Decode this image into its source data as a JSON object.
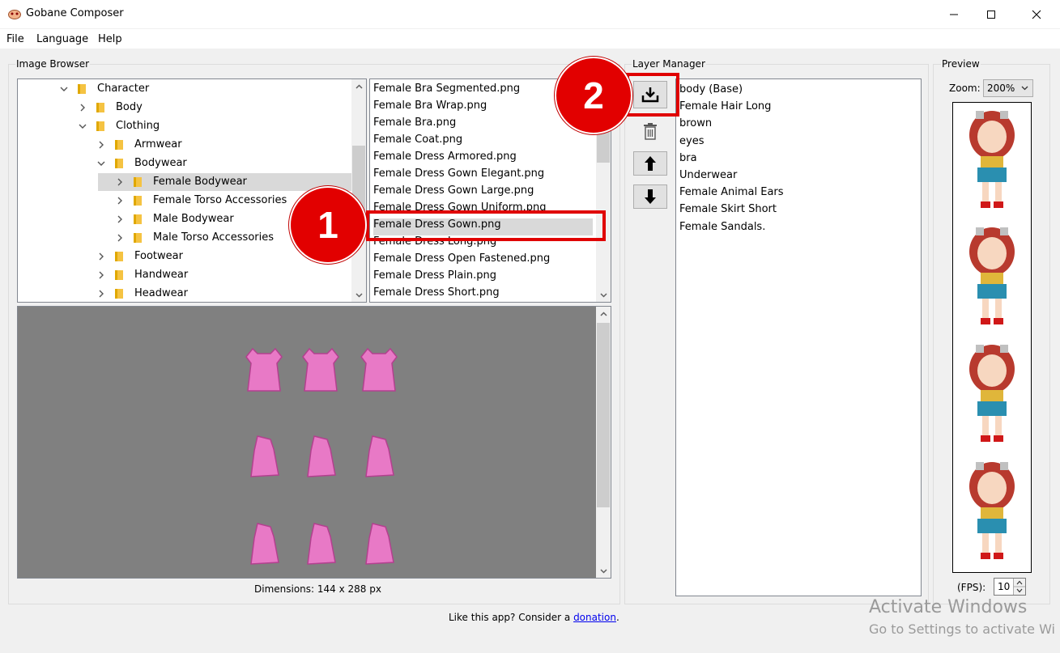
{
  "window": {
    "title": "Gobane Composer"
  },
  "menu": {
    "items": [
      "File",
      "Language",
      "Help"
    ]
  },
  "image_browser": {
    "label": "Image Browser",
    "tree": [
      {
        "label": "Character",
        "expanded": true
      },
      {
        "label": "Body",
        "expanded": false
      },
      {
        "label": "Clothing",
        "expanded": true
      },
      {
        "label": "Armwear",
        "expanded": false
      },
      {
        "label": "Bodywear",
        "expanded": true
      },
      {
        "label": "Female Bodywear",
        "expanded": false,
        "selected": true
      },
      {
        "label": "Female Torso Accessories",
        "expanded": false
      },
      {
        "label": "Male Bodywear",
        "expanded": false
      },
      {
        "label": "Male Torso Accessories",
        "expanded": false
      },
      {
        "label": "Footwear",
        "expanded": false
      },
      {
        "label": "Handwear",
        "expanded": false
      },
      {
        "label": "Headwear",
        "expanded": false
      }
    ],
    "files": [
      "Female Bra Segmented.png",
      "Female Bra Wrap.png",
      "Female Bra.png",
      "Female Coat.png",
      "Female Dress Armored.png",
      "Female Dress Gown Elegant.png",
      "Female Dress Gown Large.png",
      "Female Dress Gown Uniform.png",
      "Female Dress Gown.png",
      "Female Dress Long.png",
      "Female Dress Open Fastened.png",
      "Female Dress Plain.png",
      "Female Dress Short.png"
    ],
    "selected_file": "Female Dress Gown.png",
    "dimensions": "Dimensions: 144 x 288 px"
  },
  "layer_manager": {
    "label": "Layer Manager",
    "layers": [
      "body (Base)",
      "Female Hair Long",
      "brown",
      "eyes",
      "bra",
      "Underwear",
      "Female Animal Ears",
      "Female Skirt Short",
      "Female Sandals."
    ],
    "buttons": [
      "add-layer-icon",
      "trash-icon",
      "arrow-up-icon",
      "arrow-down-icon"
    ]
  },
  "preview": {
    "label": "Preview",
    "zoom_label": "Zoom:",
    "zoom_value": "200%",
    "fps_label": "(FPS):",
    "fps_value": "10"
  },
  "callouts": [
    "1",
    "2"
  ],
  "footer": {
    "text": "Like this app? Consider a ",
    "link": "donation",
    "suffix": "."
  },
  "watermark": {
    "line1": "Activate Windows",
    "line2": "Go to Settings to activate Wi"
  },
  "colors": {
    "callout_red": "#e20000",
    "selection_gray": "#d9d9d9",
    "dress_pink": "#e879c6",
    "preview_bg": "#808080"
  }
}
